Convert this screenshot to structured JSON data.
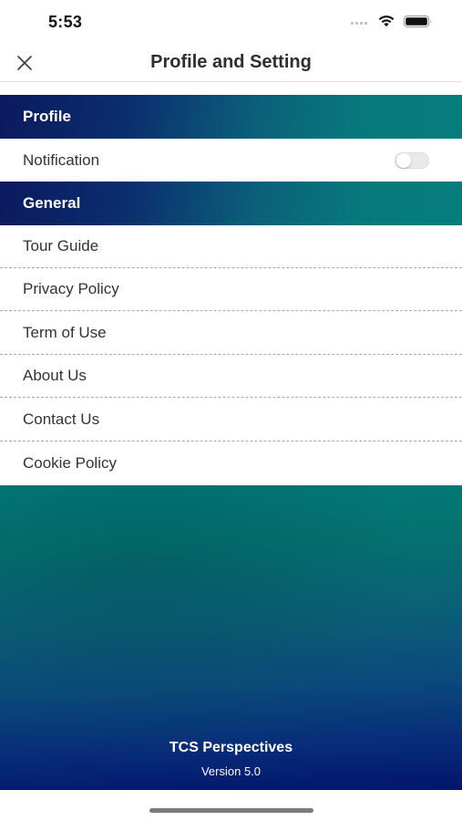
{
  "status_bar": {
    "time": "5:53",
    "icons": [
      "signal-dots-icon",
      "wifi-icon",
      "battery-icon"
    ]
  },
  "nav": {
    "title": "Profile and Setting",
    "close_icon": "close-icon"
  },
  "sections": {
    "profile": {
      "header": "Profile",
      "items": [
        {
          "label": "Notification",
          "toggle_on": false
        }
      ]
    },
    "general": {
      "header": "General",
      "items": [
        {
          "label": "Tour Guide"
        },
        {
          "label": "Privacy Policy"
        },
        {
          "label": "Term of Use"
        },
        {
          "label": "About Us"
        },
        {
          "label": "Contact Us"
        },
        {
          "label": "Cookie Policy"
        }
      ]
    }
  },
  "footer": {
    "app_name": "TCS Perspectives",
    "version": "Version 5.0"
  },
  "colors": {
    "gradient_navy": "#0b1a5e",
    "gradient_teal": "#067d7c",
    "footer_bottom": "#03156d"
  }
}
